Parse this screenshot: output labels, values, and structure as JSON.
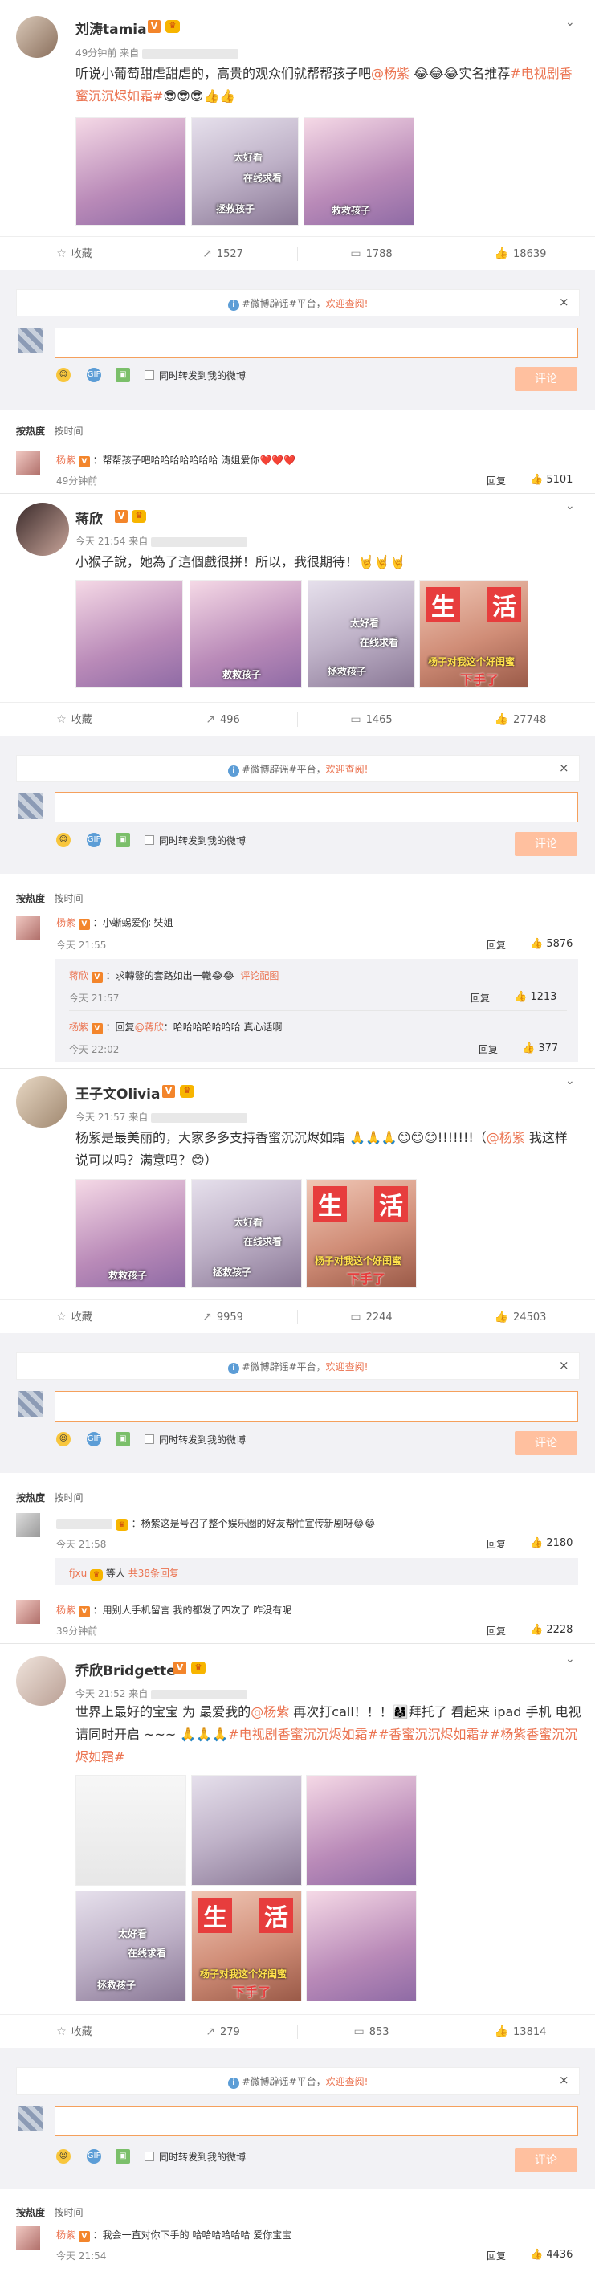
{
  "labels": {
    "collect": "收藏",
    "reply": "回复",
    "post": "评论",
    "forward": "同时转发到我的微博",
    "hot": "按热度",
    "time": "按时间",
    "notice_tag": "#微博辟谣#平台，",
    "notice_red": "欢迎查阅!",
    "close": "×"
  },
  "posts": [
    {
      "name": "刘涛tamia",
      "meta": "49分钟前 来自",
      "text_a": "听说小葡萄甜虐甜虐的，高贵的观众们就帮帮孩子吧",
      "mention": "@杨紫",
      "text_b": " 😂😂😂实名推荐",
      "tag": "#电视剧香蜜沉沉烬如霜#",
      "text_c": "😎😎😎👍👍",
      "reposts": "1527",
      "comments": "1788",
      "likes": "18639"
    },
    {
      "name": "蒋欣",
      "meta": "今天 21:54 来自",
      "text_a": "小猴子說，她為了這個戲很拼！所以，我很期待！🤘🤘🤘",
      "reposts": "496",
      "comments": "1465",
      "likes": "27748"
    },
    {
      "name": "王子文Olivia",
      "meta": "今天 21:57 来自",
      "text_a": "杨紫是最美丽的，大家多多支持香蜜沉沉烬如霜 🙏🙏🙏😊😊😊!!!!!!!（",
      "mention": "@杨紫",
      "text_b": " 我这样说可以吗？满意吗？😊）",
      "reposts": "9959",
      "comments": "2244",
      "likes": "24503"
    },
    {
      "name": "乔欣Bridgette",
      "meta": "今天 21:52 来自",
      "text_a": "世界上最好的宝宝 为 最爱我的",
      "mention": "@杨紫",
      "text_b": " 再次打call！！！👩‍👩‍👧拜托了 看起来 ipad 手机 电视 请同时开启 ~~~ 🙏🙏🙏",
      "tag": "#电视剧香蜜沉沉烬如霜##香蜜沉沉烬如霜##杨紫香蜜沉沉烬如霜#",
      "reposts": "279",
      "comments": "853",
      "likes": "13814"
    }
  ],
  "pictures": {
    "c1": "太好看",
    "c2": "在线求看",
    "c3": "救救孩子",
    "c4": "拯救孩子",
    "big1": "生",
    "big2": "活",
    "c5": "下手了",
    "c6": "杨子对我这个好闺蜜"
  },
  "comments": [
    {
      "name": "杨紫",
      "text": "：帮帮孩子吧哈哈哈哈哈哈哈 涛姐爱你❤️❤️❤️",
      "time": "49分钟前",
      "likes": "5101"
    },
    {
      "name": "杨紫",
      "text": "：小蜥蜴爱你 奘姐",
      "time": "今天 21:55",
      "likes": "5876"
    },
    {
      "name": "蒋欣",
      "text": "：求轉發的套路如出一轍😂😂",
      "extra": "评论配图",
      "time": "今天 21:57",
      "likes": "1213"
    },
    {
      "name": "杨紫",
      "text": "：回复",
      "mention": "@蒋欣",
      "text2": "：哈哈哈哈哈哈哈 真心话啊",
      "time": "今天 22:02",
      "likes": "377"
    },
    {
      "name": "",
      "text": "：杨紫这是号召了整个娱乐圈的好友帮忙宣传新剧呀😂😂",
      "time": "今天 21:58",
      "likes": "2180"
    },
    {
      "name": "fjxu",
      "text": "等人",
      "count": "共38条回复"
    },
    {
      "name": "杨紫",
      "text": "：用别人手机留言 我的都发了四次了 咋没有呢",
      "time": "39分钟前",
      "likes": "2228"
    },
    {
      "name": "杨紫",
      "text": "：我会一直对你下手的 哈哈哈哈哈哈 爱你宝宝",
      "time": "今天 21:54",
      "likes": "4436"
    }
  ]
}
